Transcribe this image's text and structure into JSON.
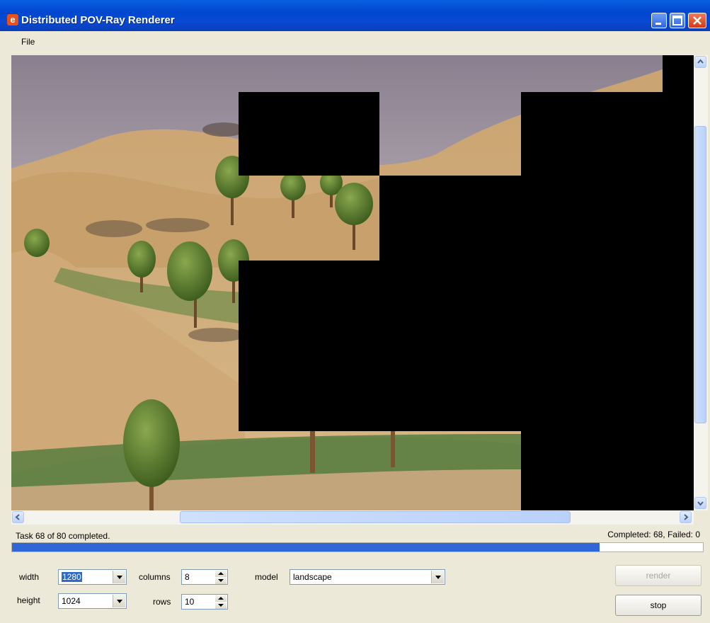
{
  "window": {
    "title": "Distributed POV-Ray Renderer",
    "logo_letter": "e"
  },
  "menu": {
    "file": "File"
  },
  "status": {
    "left": "Task 68 of 80 completed.",
    "right": "Completed: 68, Failed: 0"
  },
  "progress": {
    "fraction": 0.85
  },
  "settings": {
    "width_label": "width",
    "width_value": "1280",
    "height_label": "height",
    "height_value": "1024",
    "columns_label": "columns",
    "columns_value": "8",
    "rows_label": "rows",
    "rows_value": "10",
    "model_label": "model",
    "model_value": "landscape"
  },
  "buttons": {
    "render": "render",
    "stop": "stop"
  },
  "icons": [
    "app-logo-icon",
    "minimize-icon",
    "maximize-icon",
    "close-icon",
    "scroll-up-icon",
    "scroll-down-icon",
    "scroll-left-icon",
    "scroll-right-icon"
  ]
}
